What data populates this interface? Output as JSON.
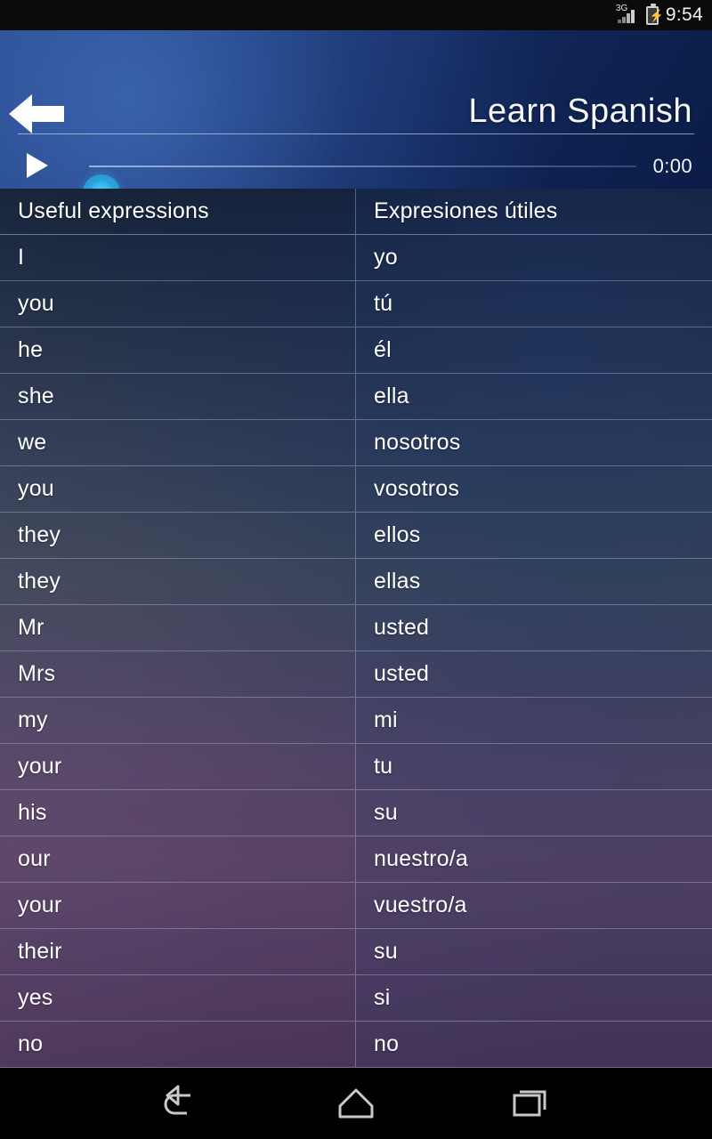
{
  "status_bar": {
    "network_label": "3G",
    "signal_icon": "signal-bars-icon",
    "battery_icon": "battery-charging-icon",
    "clock": "9:54"
  },
  "app_bar": {
    "back_icon": "back-arrow-icon",
    "title": "Learn Spanish"
  },
  "player": {
    "play_icon": "play-icon",
    "seek_thumb_icon": "seek-thumb-icon",
    "elapsed_time": "0:00",
    "progress_percent": 0
  },
  "table": {
    "headers": {
      "source": "Useful expressions",
      "target": "Expresiones útiles"
    },
    "rows": [
      {
        "source": "I",
        "target": "yo"
      },
      {
        "source": "you",
        "target": "tú"
      },
      {
        "source": "he",
        "target": "él"
      },
      {
        "source": "she",
        "target": "ella"
      },
      {
        "source": "we",
        "target": "nosotros"
      },
      {
        "source": "you",
        "target": "vosotros"
      },
      {
        "source": "they",
        "target": "ellos"
      },
      {
        "source": "they",
        "target": "ellas"
      },
      {
        "source": "Mr",
        "target": "usted"
      },
      {
        "source": "Mrs",
        "target": "usted"
      },
      {
        "source": "my",
        "target": "mi"
      },
      {
        "source": "your",
        "target": "tu"
      },
      {
        "source": "his",
        "target": "su"
      },
      {
        "source": "our",
        "target": "nuestro/a"
      },
      {
        "source": "your",
        "target": "vuestro/a"
      },
      {
        "source": "their",
        "target": "su"
      },
      {
        "source": "yes",
        "target": "si"
      },
      {
        "source": "no",
        "target": "no"
      }
    ],
    "partial_row": {
      "source": "",
      "target": ""
    }
  },
  "nav_bar": {
    "back_icon": "nav-back-icon",
    "home_icon": "nav-home-icon",
    "recents_icon": "nav-recents-icon"
  },
  "colors": {
    "accent": "#2ba0da",
    "header_blue": "#2a4c8f",
    "table_top": "#111d33",
    "table_bottom": "#473253",
    "text": "#ffffff"
  }
}
